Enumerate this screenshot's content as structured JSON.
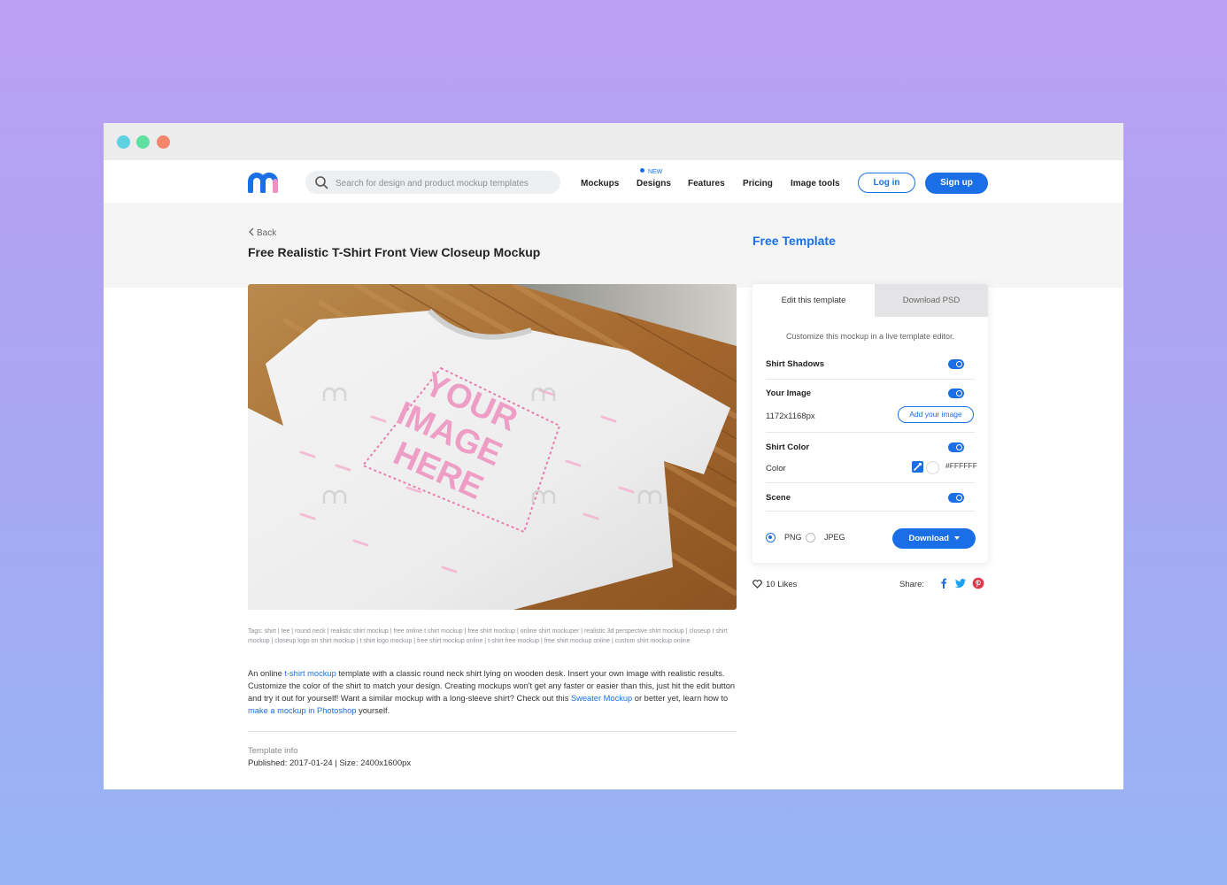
{
  "colors": {
    "accent": "#1a6fe6",
    "logo_blue": "#1a6fe6",
    "logo_pink": "#f08fc4",
    "dot_cyan": "#5fd1e3",
    "dot_green": "#5ee1a0",
    "dot_red": "#f4856b",
    "pinterest": "#e0364a"
  },
  "search": {
    "placeholder": "Search for design and product mockup templates",
    "icon": "search-icon"
  },
  "nav": {
    "links": [
      "Mockups",
      "Designs",
      "Features",
      "Pricing",
      "Image tools"
    ],
    "new_badge": "NEW",
    "login": "Log in",
    "signup": "Sign up"
  },
  "header": {
    "back": "Back",
    "title": "Free Realistic T-Shirt Front View Closeup Mockup",
    "free_template": "Free Template"
  },
  "mockup": {
    "placeholder_lines": [
      "YOUR",
      "IMAGE",
      "HERE"
    ]
  },
  "panel": {
    "tabs": [
      "Edit this template",
      "Download PSD"
    ],
    "subtitle": "Customize this mockup in a live template editor.",
    "shirt_shadows": "Shirt Shadows",
    "your_image": "Your Image",
    "image_size": "1172x1168px",
    "add_image": "Add your image",
    "shirt_color": "Shirt Color",
    "color_label": "Color",
    "color_value": "#FFFFFF",
    "scene": "Scene",
    "format_png": "PNG",
    "format_jpeg": "JPEG",
    "download": "Download"
  },
  "social": {
    "likes": "10 Likes",
    "share": "Share:"
  },
  "tags": "Tags: shirt | tee | round neck | realistic shirt mockup | free online t shirt mockup | free shirt mockup | online shirt mockuper | realistic 3d perspective shirt mockup | closeup t shirt mockup | closeup logo on shirt mockup | t shirt logo mockup | free shirt mockup online | t-shirt free mockup | free shirt mockup online | custom shirt mockup online",
  "description": {
    "p1": "An online ",
    "link1": "t-shirt mockup",
    "p2": " template with a classic round neck shirt lying on wooden desk. Insert your own image with realistic results. Customize the color of the shirt to match your design. Creating mockups won't get any faster or easier than this, just hit the edit button and try it out for yourself! Want a similar mockup with a long-sleeve shirt? Check out this ",
    "link2": "Sweater Mockup",
    "p3": " or better yet, learn how to ",
    "link3": "make a mockup in Photoshop",
    "p4": " yourself."
  },
  "template_info": {
    "label": "Template info",
    "value": "Published: 2017-01-24 | Size: 2400x1600px"
  }
}
